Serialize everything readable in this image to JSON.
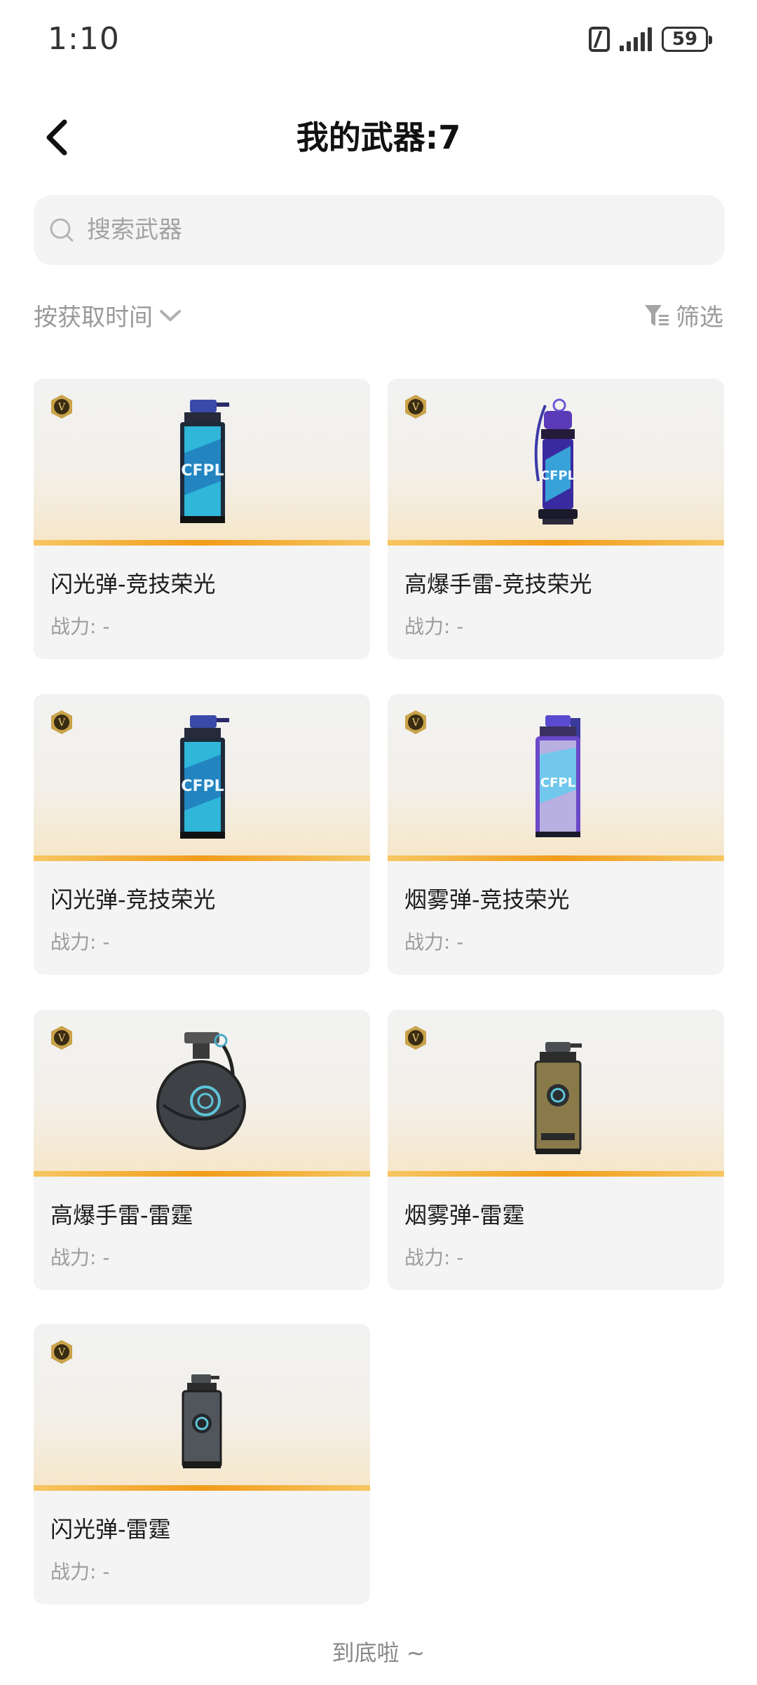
{
  "status_bar": {
    "time": "1:10",
    "battery": "59"
  },
  "header": {
    "title": "我的武器:7"
  },
  "search": {
    "placeholder": "搜索武器"
  },
  "toolbar": {
    "sort_label": "按获取时间",
    "filter_label": "筛选"
  },
  "items": [
    {
      "name": "闪光弹-竞技荣光",
      "power": "战力: -",
      "icon": "flashbang-blue-icon"
    },
    {
      "name": "高爆手雷-竞技荣光",
      "power": "战力: -",
      "icon": "grenade-purple-icon"
    },
    {
      "name": "闪光弹-竞技荣光",
      "power": "战力: -",
      "icon": "flashbang-blue-icon"
    },
    {
      "name": "烟雾弹-竞技荣光",
      "power": "战力: -",
      "icon": "smoke-purple-icon"
    },
    {
      "name": "高爆手雷-雷霆",
      "power": "战力: -",
      "icon": "sphere-grenade-icon"
    },
    {
      "name": "烟雾弹-雷霆",
      "power": "战力: -",
      "icon": "smoke-bronze-icon"
    },
    {
      "name": "闪光弹-雷霆",
      "power": "战力: -",
      "icon": "flashbang-dark-icon"
    }
  ],
  "footer": {
    "end_text": "到底啦 ~"
  },
  "colors": {
    "accent_bar": "#f29c1a",
    "card_bg": "#f4f4f4",
    "badge": "#c9a24a"
  }
}
